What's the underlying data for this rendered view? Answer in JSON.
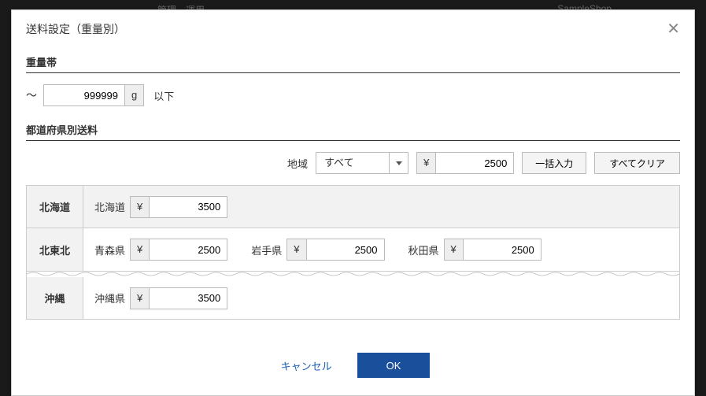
{
  "backdrop": {
    "nav": "管理　運用",
    "shop": "SampleShop"
  },
  "modal": {
    "title": "送料設定（重量別）",
    "weight": {
      "section_label": "重量帯",
      "tilde": "〜",
      "value": "999999",
      "unit": "g",
      "suffix": "以下"
    },
    "region": {
      "section_label": "都道府県別送料",
      "area_label": "地域",
      "area_select": "すべて",
      "yen": "¥",
      "bulk_price": "2500",
      "bulk_apply": "一括入力",
      "clear_all": "すべてクリア"
    },
    "groups": [
      {
        "name": "北海道",
        "active": true,
        "prefs": [
          {
            "name": "北海道",
            "price": "3500"
          }
        ]
      },
      {
        "name": "北東北",
        "active": false,
        "prefs": [
          {
            "name": "青森県",
            "price": "2500"
          },
          {
            "name": "岩手県",
            "price": "2500"
          },
          {
            "name": "秋田県",
            "price": "2500"
          }
        ]
      },
      {
        "name": "沖縄",
        "active": false,
        "prefs": [
          {
            "name": "沖縄県",
            "price": "3500"
          }
        ]
      }
    ],
    "footer": {
      "cancel": "キャンセル",
      "ok": "OK"
    }
  }
}
